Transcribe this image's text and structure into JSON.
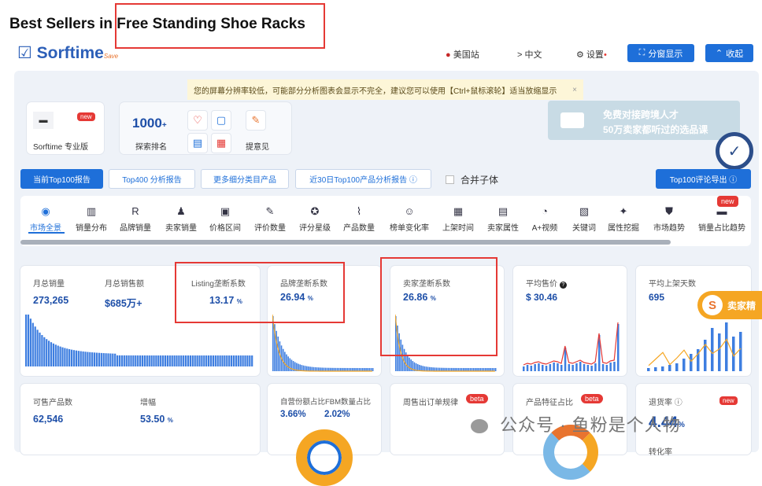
{
  "page": {
    "title": "Best Sellers in Free Standing Shoe Racks"
  },
  "header": {
    "logo": "Sorftime",
    "logo_sub": "Save",
    "site": "美国站",
    "lang": "> 中文",
    "settings": "设置",
    "split_btn": "分窗显示",
    "collapse_btn": "收起"
  },
  "notice": {
    "text": "您的屏幕分辨率较低，可能部分分析图表会显示不完全，建议您可以使用【Ctrl+鼠标滚轮】适当放缩显示",
    "close": "×"
  },
  "plan_card": {
    "label": "Sorftime 专业版",
    "badge": "new"
  },
  "rank_card": {
    "value": "1000",
    "plus": "+",
    "label": "探索排名"
  },
  "feedback": {
    "label": "提意见"
  },
  "banner": {
    "line1": "免费对接跨境人才",
    "line2": "50万卖家都听过的选品课"
  },
  "buttons": {
    "top100": "当前Top100报告",
    "top400": "Top400 分析报告",
    "more_sub": "更多细分类目产品",
    "recent30": "近30日Top100产品分析报告 ⓘ",
    "merge_child": "合并子体",
    "export": "Top100评论导出 ⓘ"
  },
  "nav": {
    "badge": "new",
    "items": [
      {
        "label": "市场全景",
        "icon": "market-icon",
        "glyph": "◉"
      },
      {
        "label": "销量分布",
        "icon": "bar-chart-icon",
        "glyph": "▥"
      },
      {
        "label": "品牌销量",
        "icon": "brand-icon",
        "glyph": "R"
      },
      {
        "label": "卖家销量",
        "icon": "seller-icon",
        "glyph": "♟"
      },
      {
        "label": "价格区间",
        "icon": "price-icon",
        "glyph": "▣"
      },
      {
        "label": "评价数量",
        "icon": "review-icon",
        "glyph": "✎"
      },
      {
        "label": "评分星级",
        "icon": "star-icon",
        "glyph": "✪"
      },
      {
        "label": "产品数量",
        "icon": "trend-icon",
        "glyph": "⌇"
      },
      {
        "label": "榜单变化率",
        "icon": "rank-change-icon",
        "glyph": "☺"
      },
      {
        "label": "上架时间",
        "icon": "calendar-icon",
        "glyph": "▦"
      },
      {
        "label": "卖家属性",
        "icon": "attribute-icon",
        "glyph": "▤"
      },
      {
        "label": "A+视频",
        "icon": "video-icon",
        "glyph": "◔"
      },
      {
        "label": "关键词",
        "icon": "keyword-icon",
        "glyph": "▧"
      },
      {
        "label": "属性挖掘",
        "icon": "puzzle-icon",
        "glyph": "✦"
      },
      {
        "label": "市场趋势",
        "icon": "market-trend-icon",
        "glyph": "⛊"
      },
      {
        "label": "销量占比趋势",
        "icon": "share-trend-icon",
        "glyph": "▬"
      }
    ]
  },
  "metrics": {
    "monthly_sales_label": "月总销量",
    "monthly_sales": "273,265",
    "monthly_revenue_label": "月总销售额",
    "monthly_revenue": "$685万+",
    "listing_label": "Listing垄断系数",
    "listing_value": "13.17",
    "listing_unit": "%",
    "brand_label": "品牌垄断系数",
    "brand_value": "26.94",
    "brand_unit": "%",
    "seller_label": "卖家垄断系数",
    "seller_value": "26.86",
    "seller_unit": "%",
    "avg_price_label": "平均售价",
    "avg_price": "$ 30.46",
    "avg_days_label": "平均上架天数",
    "avg_days": "695",
    "products_label": "可售产品数",
    "products": "62,546",
    "growth_label": "增幅",
    "growth": "53.50",
    "growth_unit": "%",
    "self_label": "自营份额占比FBM数量占比",
    "self_a": "3.66%",
    "self_b": "2.02%",
    "weekly_label": "周售出订单规律",
    "weekly_badge": "beta",
    "feature_label": "产品特征占比",
    "feature_badge": "beta",
    "return_label": "退货率 ⓘ",
    "return_value": "4.44",
    "return_unit": "%",
    "return_badge": "new",
    "conversion_label": "转化率"
  },
  "side_float": {
    "label": "卖家精",
    "glyph": "S"
  },
  "watermark": {
    "text": "公众号 · 鱼粉是个人物"
  },
  "colors": {
    "primary": "#1e6fd9",
    "bar": "#3e7ee0",
    "accent": "#f5a623",
    "red": "#e53935"
  }
}
